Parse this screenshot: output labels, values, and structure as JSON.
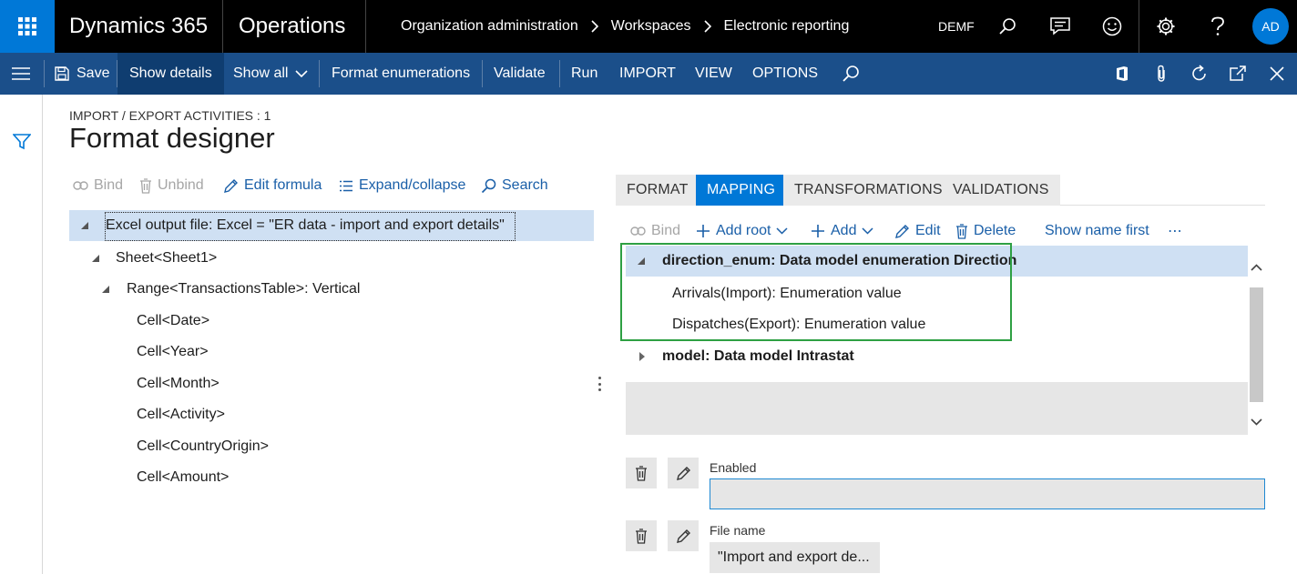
{
  "topbar": {
    "brand": "Dynamics 365",
    "module": "Operations",
    "breadcrumbs": [
      "Organization administration",
      "Workspaces",
      "Electronic reporting"
    ],
    "company": "DEMF",
    "avatar_initials": "AD",
    "icons": [
      "waffle-icon",
      "search-icon",
      "message-icon",
      "smiley-icon",
      "gear-icon",
      "help-icon"
    ]
  },
  "actionbar": {
    "save": "Save",
    "show_details": "Show details",
    "show_all": "Show all",
    "format_enumerations": "Format enumerations",
    "validate": "Validate",
    "run": "Run",
    "import": "IMPORT",
    "view": "VIEW",
    "options": "OPTIONS",
    "right_icons": [
      "office-icon",
      "attachment-icon",
      "refresh-icon",
      "popout-icon",
      "close-icon"
    ]
  },
  "page": {
    "caption": "IMPORT / EXPORT ACTIVITIES : 1",
    "title": "Format designer"
  },
  "format_toolbar": {
    "bind": "Bind",
    "unbind": "Unbind",
    "edit_formula": "Edit formula",
    "expand_collapse": "Expand/collapse",
    "search": "Search"
  },
  "format_tree": [
    {
      "label": "Excel output file: Excel = \"ER data - import and export details\"",
      "level": 0,
      "expanded": true,
      "selected": true
    },
    {
      "label": "Sheet<Sheet1>",
      "level": 1,
      "expanded": true
    },
    {
      "label": "Range<TransactionsTable>: Vertical",
      "level": 2,
      "expanded": true
    },
    {
      "label": "Cell<Date>",
      "level": 3
    },
    {
      "label": "Cell<Year>",
      "level": 3
    },
    {
      "label": "Cell<Month>",
      "level": 3
    },
    {
      "label": "Cell<Activity>",
      "level": 3
    },
    {
      "label": "Cell<CountryOrigin>",
      "level": 3
    },
    {
      "label": "Cell<Amount>",
      "level": 3
    }
  ],
  "tabs": [
    {
      "label": "FORMAT",
      "active": false
    },
    {
      "label": "MAPPING",
      "active": true
    },
    {
      "label": "TRANSFORMATIONS",
      "active": false
    },
    {
      "label": "VALIDATIONS",
      "active": false
    }
  ],
  "mapping_toolbar": {
    "bind": "Bind",
    "add_root": "Add root",
    "add": "Add",
    "edit": "Edit",
    "delete": "Delete",
    "show_name_first": "Show name first",
    "more": "⋯"
  },
  "mapping_tree": [
    {
      "label": "direction_enum: Data model enumeration Direction",
      "bold": true,
      "expanded": true,
      "selected": true
    },
    {
      "label": "Arrivals(Import): Enumeration value",
      "bold": false
    },
    {
      "label": "Dispatches(Export): Enumeration value",
      "bold": false
    },
    {
      "label": "model: Data model Intrastat",
      "bold": true,
      "expanded": false
    }
  ],
  "fields": {
    "enabled_label": "Enabled",
    "enabled_value": "",
    "file_name_label": "File name",
    "file_name_value": "\"Import and export de..."
  },
  "colors": {
    "brand_blue": "#0078d7",
    "action_pane": "#1b4f8a",
    "selection": "#cfe0f3",
    "highlight_box": "#2ea043",
    "link": "#1a5fa8"
  }
}
